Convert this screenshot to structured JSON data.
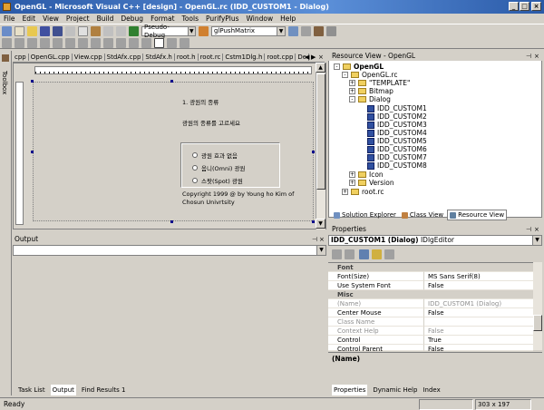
{
  "window": {
    "title": "OpenGL - Microsoft Visual C++ [design] - OpenGL.rc (IDD_CUSTOM1 - Dialog)"
  },
  "menu": [
    "File",
    "Edit",
    "View",
    "Project",
    "Build",
    "Debug",
    "Format",
    "Tools",
    "PurifyPlus",
    "Window",
    "Help"
  ],
  "toolbar": {
    "config": "Pseudo-Debug",
    "find": "glPushMatrix"
  },
  "toolbox": {
    "label": "Toolbox"
  },
  "doc_tabs": [
    "cpp",
    "OpenGL.cpp",
    "View.cpp",
    "StdAfx.cpp",
    "StdAfx.h",
    "root.h",
    "root.rc",
    "Cstm1Dlg.h",
    "root.cpp",
    "De"
  ],
  "dialog": {
    "heading": "1. 광원의 종류",
    "prompt": "광원의 종류를 고르세요",
    "options": [
      "광원 효과 없음",
      "옴니(Omni) 광원",
      "스팟(Spot) 광원"
    ],
    "copyright_line1": "Copyright 1999 @ by Young ho Kim of",
    "copyright_line2": "Chosun Univrtsity"
  },
  "output": {
    "title": "Output",
    "tabs": [
      "Task List",
      "Output",
      "Find Results 1"
    ]
  },
  "resource_view": {
    "title": "Resource View - OpenGL",
    "root": "OpenGL",
    "rc": "OpenGL.rc",
    "folders": [
      "\"TEMPLATE\"",
      "Bitmap",
      "Dialog"
    ],
    "dialogs": [
      "IDD_CUSTOM1",
      "IDD_CUSTOM2",
      "IDD_CUSTOM3",
      "IDD_CUSTOM4",
      "IDD_CUSTOM5",
      "IDD_CUSTOM6",
      "IDD_CUSTOM7",
      "IDD_CUSTOM8"
    ],
    "after": [
      "Icon",
      "Version"
    ],
    "root_rc": "root.rc",
    "tabs": [
      "Solution Explorer",
      "Class View",
      "Resource View"
    ]
  },
  "properties": {
    "title": "Properties",
    "object": "IDD_CUSTOM1 (Dialog)",
    "object_type": "IDlgEditor",
    "rows": [
      {
        "k": "Font",
        "v": "",
        "cat": true
      },
      {
        "k": "Font(Size)",
        "v": "MS Sans Serif(8)"
      },
      {
        "k": "Use System Font",
        "v": "False"
      },
      {
        "k": "Misc",
        "v": "",
        "cat": true
      },
      {
        "k": "(Name)",
        "v": "IDD_CUSTOM1 (Dialog)",
        "gray": true
      },
      {
        "k": "Center Mouse",
        "v": "False"
      },
      {
        "k": "Class Name",
        "v": "",
        "gray": true
      },
      {
        "k": "Context Help",
        "v": "False",
        "gray": true
      },
      {
        "k": "Control",
        "v": "True"
      },
      {
        "k": "Control Parent",
        "v": "False"
      }
    ],
    "description": "(Name)",
    "tabs": [
      "Properties",
      "Dynamic Help",
      "Index"
    ]
  },
  "status": {
    "text": "Ready",
    "size": "303 x 197"
  }
}
